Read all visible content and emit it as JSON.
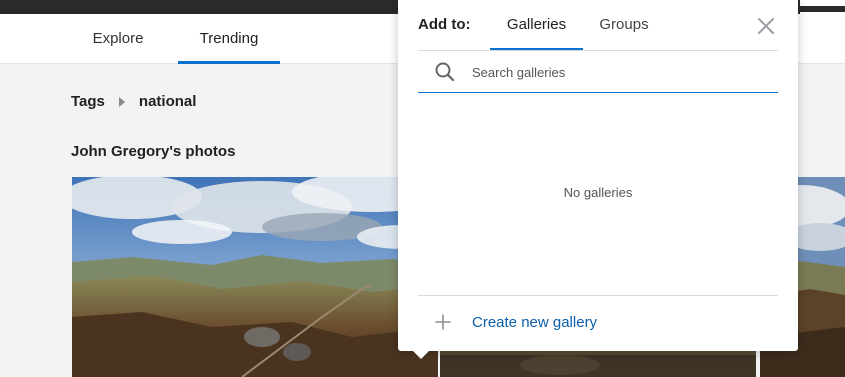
{
  "nav": {
    "tabs": [
      {
        "label": "Explore"
      },
      {
        "label": "Trending"
      }
    ]
  },
  "breadcrumb": {
    "root": "Tags",
    "current": "national"
  },
  "section": {
    "title": "John Gregory's photos"
  },
  "popover": {
    "add_to_label": "Add to:",
    "tabs": [
      {
        "label": "Galleries"
      },
      {
        "label": "Groups"
      }
    ],
    "search": {
      "placeholder": "Search galleries",
      "value": ""
    },
    "empty_text": "No galleries",
    "create_label": "Create new gallery"
  },
  "icons": {
    "search": "search-icon",
    "close": "close-icon",
    "plus": "plus-icon",
    "chevron": "chevron-right-icon"
  },
  "colors": {
    "accent": "#0870d1",
    "link": "#0a5fa8",
    "topbar": "#2a2a2a",
    "background": "#f2f3f4"
  }
}
